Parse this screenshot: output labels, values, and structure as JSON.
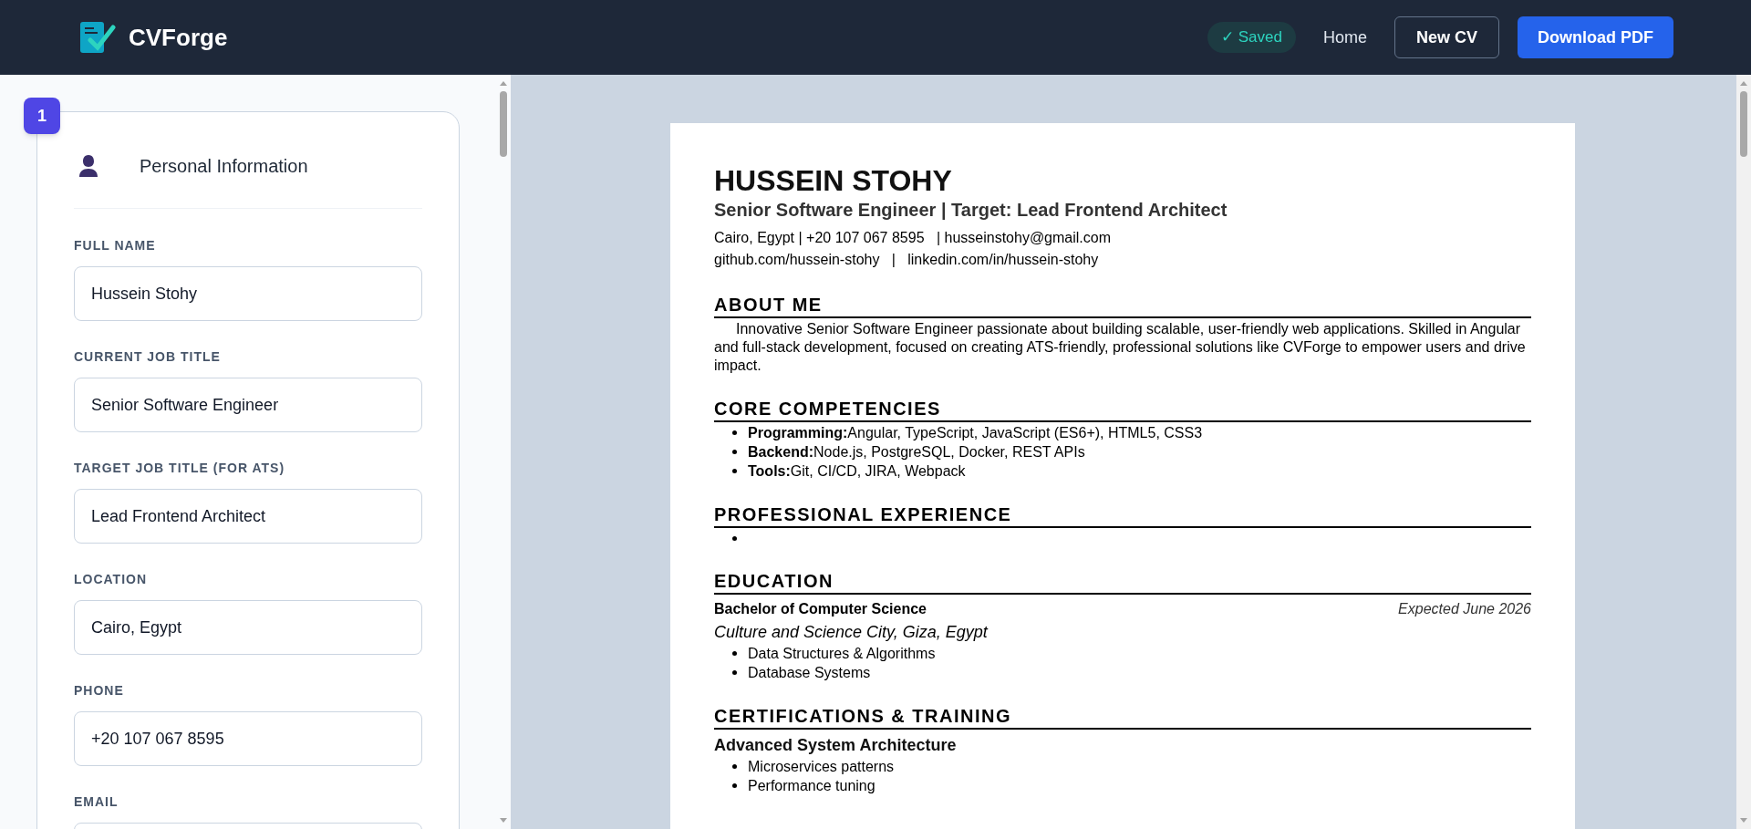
{
  "header": {
    "brand": "CVForge",
    "status": {
      "label": "✓ Saved",
      "saved": true
    },
    "nav_link": "Home",
    "buttons": [
      {
        "label": "New CV",
        "kind": "outline"
      },
      {
        "label": "Download PDF",
        "kind": "primary"
      }
    ]
  },
  "form": {
    "step": "1",
    "section_title": "Personal Information",
    "fields": [
      {
        "label": "FULL NAME",
        "value": "Hussein Stohy"
      },
      {
        "label": "CURRENT JOB TITLE",
        "value": "Senior Software Engineer"
      },
      {
        "label": "TARGET JOB TITLE (FOR ATS)",
        "value": "Lead Frontend Architect"
      },
      {
        "label": "LOCATION",
        "value": "Cairo, Egypt"
      },
      {
        "label": "PHONE",
        "value": "+20 107 067 8595"
      },
      {
        "label": "EMAIL"
      }
    ]
  },
  "resume": {
    "name": "HUSSEIN STOHY",
    "headline": "Senior Software Engineer | Target: Lead Frontend Architect",
    "contact_lines": [
      "Cairo, Egypt | +20 107 067 8595   | husseinstohy@gmail.com",
      "github.com/hussein-stohy   |   linkedin.com/in/hussein-stohy"
    ],
    "sections": [
      {
        "kind": "paragraph",
        "title": "ABOUT ME",
        "text": "Innovative Senior Software Engineer passionate about building scalable, user-friendly web applications. Skilled in Angular and full-stack development, focused on creating ATS-friendly, professional solutions like CVForge to empower users and drive impact."
      },
      {
        "kind": "list",
        "title": "CORE COMPETENCIES",
        "items": [
          "**Programming:**Angular, TypeScript, JavaScript (ES6+), HTML5, CSS3",
          "**Backend:**Node.js, PostgreSQL, Docker, REST APIs",
          "**Tools:**Git, CI/CD, JIRA, Webpack"
        ]
      },
      {
        "kind": "empty_list",
        "title": "PROFESSIONAL EXPERIENCE"
      },
      {
        "kind": "education",
        "title": "EDUCATION",
        "degree": "Bachelor of Computer Science",
        "date": "Expected June 2026",
        "place": "Culture and Science City, Giza, Egypt",
        "items": [
          "Data Structures & Algorithms",
          "Database Systems"
        ]
      },
      {
        "kind": "certification",
        "title": "CERTIFICATIONS & TRAINING",
        "name": "Advanced System Architecture",
        "items": [
          "Microservices patterns",
          "Performance tuning"
        ]
      }
    ]
  }
}
